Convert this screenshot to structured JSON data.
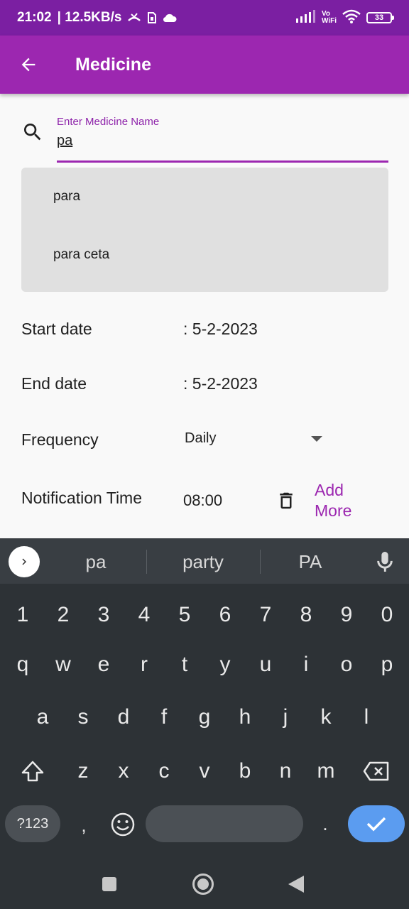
{
  "status_bar": {
    "time": "21:02",
    "speed": "| 12.5KB/s",
    "vowifi_top": "Vo",
    "vowifi_bottom": "WiFi",
    "battery": "33"
  },
  "app_bar": {
    "title": "Medicine"
  },
  "search": {
    "label": "Enter Medicine Name",
    "value": "pa"
  },
  "suggestions": [
    "para",
    "para ceta"
  ],
  "form": {
    "start_date_label": "Start date",
    "start_date_value": ": 5-2-2023",
    "end_date_label": "End date",
    "end_date_value": ": 5-2-2023",
    "frequency_label": "Frequency",
    "frequency_value": "Daily",
    "notification_label": "Notification Time",
    "notification_value": "08:00",
    "add_more_line1": "Add",
    "add_more_line2": "More"
  },
  "keyboard": {
    "strip_words": [
      "pa",
      "party",
      "PA"
    ],
    "row_numbers": [
      "1",
      "2",
      "3",
      "4",
      "5",
      "6",
      "7",
      "8",
      "9",
      "0"
    ],
    "row1": [
      "q",
      "w",
      "e",
      "r",
      "t",
      "y",
      "u",
      "i",
      "o",
      "p"
    ],
    "row2": [
      "a",
      "s",
      "d",
      "f",
      "g",
      "h",
      "j",
      "k",
      "l"
    ],
    "row3": [
      "z",
      "x",
      "c",
      "v",
      "b",
      "n",
      "m"
    ],
    "num_key": "?123",
    "comma": ",",
    "period": "."
  },
  "colors": {
    "status_bar": "#7b1fa2",
    "app_bar": "#9c27b0",
    "accent": "#9c27b0",
    "keyboard_bg": "#2d3236",
    "enter_key": "#5b9cf0"
  }
}
